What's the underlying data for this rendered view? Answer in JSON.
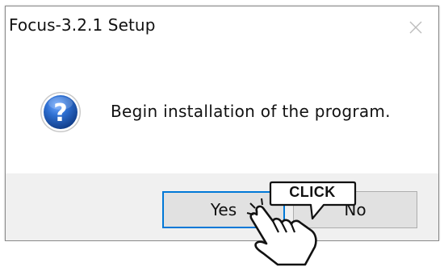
{
  "window": {
    "title": "Focus-3.2.1 Setup",
    "close_icon": "close-icon"
  },
  "message": {
    "icon": "question-icon",
    "text": "Begin installation of the program."
  },
  "buttons": {
    "yes_label": "Yes",
    "no_label": "No"
  },
  "overlay": {
    "callout_label": "CLICK",
    "cursor_icon": "hand-pointer-icon"
  },
  "colors": {
    "accent": "#0078d7",
    "footer_bg": "#f0f0f0",
    "button_bg": "#e1e1e1",
    "icon_blue": "#1f5fb3"
  }
}
